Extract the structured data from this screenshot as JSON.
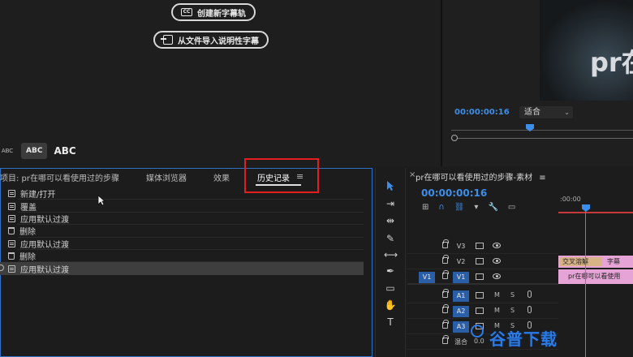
{
  "captions": {
    "create_btn": "创建新字幕轨",
    "cc_badge": "CC",
    "import_btn": "从文件导入说明性字幕",
    "abc_small": "ABC",
    "abc_medium": "ABC",
    "abc_large": "ABC"
  },
  "monitor": {
    "video_text": "pr在",
    "timecode": "00:00:00:16",
    "fit": "适合"
  },
  "panel": {
    "tabs": [
      "项目: pr在哪可以看使用过的步骤",
      "媒体浏览器",
      "效果",
      "历史记录"
    ],
    "active_tab": "历史记录",
    "menu_icon": "≡"
  },
  "history": [
    {
      "label": "新建/打开",
      "icon": "list-icon"
    },
    {
      "label": "覆盖",
      "icon": "list-icon"
    },
    {
      "label": "应用默认过渡",
      "icon": "list-icon"
    },
    {
      "label": "删除",
      "icon": "trash-icon"
    },
    {
      "label": "应用默认过渡",
      "icon": "list-icon"
    },
    {
      "label": "删除",
      "icon": "trash-icon"
    },
    {
      "label": "应用默认过渡",
      "icon": "list-icon",
      "selected": true
    }
  ],
  "timeline": {
    "close": "×",
    "title": "pr在哪可以看使用过的步骤-素材",
    "menu": "≡",
    "timecode": "00:00:00:16",
    "ruler_label": ":00:00",
    "tracks": {
      "v3": "V3",
      "v2": "V2",
      "v1": "V1",
      "src_v1": "V1",
      "a1": "A1",
      "a2": "A2",
      "a3": "A3",
      "mix": "混合",
      "mix_value": "0.0"
    },
    "m_label": "M",
    "s_label": "S",
    "clip_v2_a": "交叉溶解",
    "clip_v2_b": "字幕",
    "clip_v1": "pr在哪可以看使用"
  },
  "watermark": "谷普下载",
  "colors": {
    "accent": "#3d8ee8",
    "highlight_box": "#e31e1e",
    "clip_pink": "#e6a3d5",
    "clip_tan": "#d8b386"
  }
}
